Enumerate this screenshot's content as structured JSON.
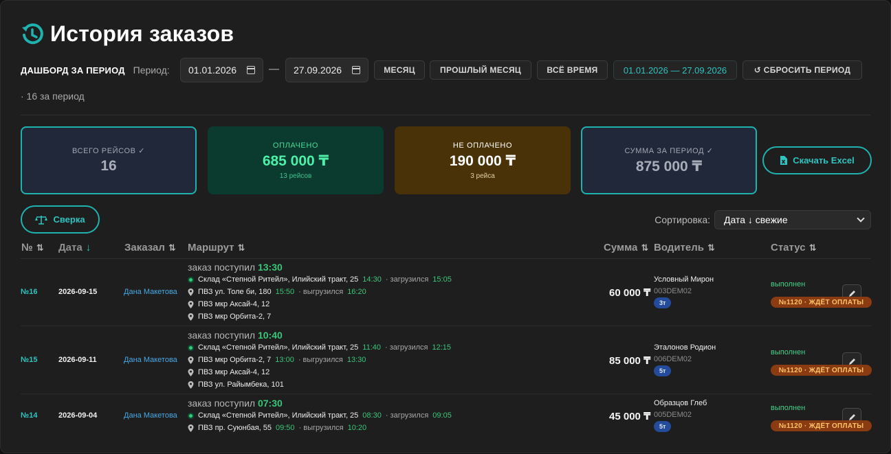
{
  "header": {
    "title": "История заказов",
    "icon": "history-icon"
  },
  "filters": {
    "dashboard_label": "ДАШБОРД ЗА ПЕРИОД",
    "period_label": "Период:",
    "date_from": "01.01.2026",
    "date_to": "27.09.2026",
    "dash": "—",
    "month": "МЕСЯЦ",
    "last_month": "ПРОШЛЫЙ МЕСЯЦ",
    "all_time": "ВСЁ ВРЕМЯ",
    "range": "01.01.2026 — 27.09.2026",
    "reset": "↺ СБРОСИТЬ ПЕРИОД",
    "count": "· 16 за период"
  },
  "cards": {
    "total": {
      "label": "ВСЕГО РЕЙСОВ ✓",
      "value": "16"
    },
    "paid": {
      "label": "ОПЛАЧЕНО",
      "value": "685 000 ₸",
      "sub": "13 рейсов"
    },
    "unpaid": {
      "label": "НЕ ОПЛАЧЕНО",
      "value": "190 000 ₸",
      "sub": "3 рейса"
    },
    "sum": {
      "label": "СУММА ЗА ПЕРИОД ✓",
      "value": "875 000 ₸"
    }
  },
  "actions": {
    "excel": "Скачать Excel",
    "reconcile": "Сверка"
  },
  "sort": {
    "label": "Сортировка:",
    "value": "Дата ↓ свежие"
  },
  "columns": {
    "num": "№",
    "date": "Дата",
    "customer": "Заказал",
    "route": "Маршрут",
    "amount": "Сумма",
    "driver": "Водитель",
    "status": "Статус",
    "sort_icon": "⇅",
    "active_icon": "↓"
  },
  "orders": [
    {
      "num": "№16",
      "date": "2026-09-15",
      "customer": "Дана Макетова",
      "received_label": "заказ поступил",
      "received_time": "13:30",
      "pickup": {
        "place": "Склад «Степной Ритейл», Илийский тракт, 25",
        "time": "14:30",
        "action": "· загрузился",
        "action_time": "15:05"
      },
      "drops": [
        {
          "place": "ПВЗ ул. Толе би, 180",
          "time": "15:50",
          "action": "· выгрузился",
          "action_time": "16:20"
        },
        {
          "place": "ПВЗ мкр Аксай-4, 12"
        },
        {
          "place": "ПВЗ мкр Орбита-2, 7"
        }
      ],
      "amount": "60 000 ₸",
      "driver": {
        "name": "Условный Мирон",
        "plate": "003DEM02",
        "tonnage": "3т"
      },
      "status": "выполнен",
      "invoice": "№1120 · ЖДЁТ ОПЛАТЫ"
    },
    {
      "num": "№15",
      "date": "2026-09-11",
      "customer": "Дана Макетова",
      "received_label": "заказ поступил",
      "received_time": "10:40",
      "pickup": {
        "place": "Склад «Степной Ритейл», Илийский тракт, 25",
        "time": "11:40",
        "action": "· загрузился",
        "action_time": "12:15"
      },
      "drops": [
        {
          "place": "ПВЗ мкр Орбита-2, 7",
          "time": "13:00",
          "action": "· выгрузился",
          "action_time": "13:30"
        },
        {
          "place": "ПВЗ мкр Аксай-4, 12"
        },
        {
          "place": "ПВЗ ул. Райымбека, 101"
        }
      ],
      "amount": "85 000 ₸",
      "driver": {
        "name": "Эталонов Родион",
        "plate": "006DEM02",
        "tonnage": "5т"
      },
      "status": "выполнен",
      "invoice": "№1120 · ЖДЁТ ОПЛАТЫ"
    },
    {
      "num": "№14",
      "date": "2026-09-04",
      "customer": "Дана Макетова",
      "received_label": "заказ поступил",
      "received_time": "07:30",
      "pickup": {
        "place": "Склад «Степной Ритейл», Илийский тракт, 25",
        "time": "08:30",
        "action": "· загрузился",
        "action_time": "09:05"
      },
      "drops": [
        {
          "place": "ПВЗ пр. Суюнбая, 55",
          "time": "09:50",
          "action": "· выгрузился",
          "action_time": "10:20"
        }
      ],
      "amount": "45 000 ₸",
      "driver": {
        "name": "Образцов Глеб",
        "plate": "005DEM02",
        "tonnage": "5т"
      },
      "status": "выполнен",
      "invoice": "№1120 · ЖДЁТ ОПЛАТЫ"
    }
  ]
}
